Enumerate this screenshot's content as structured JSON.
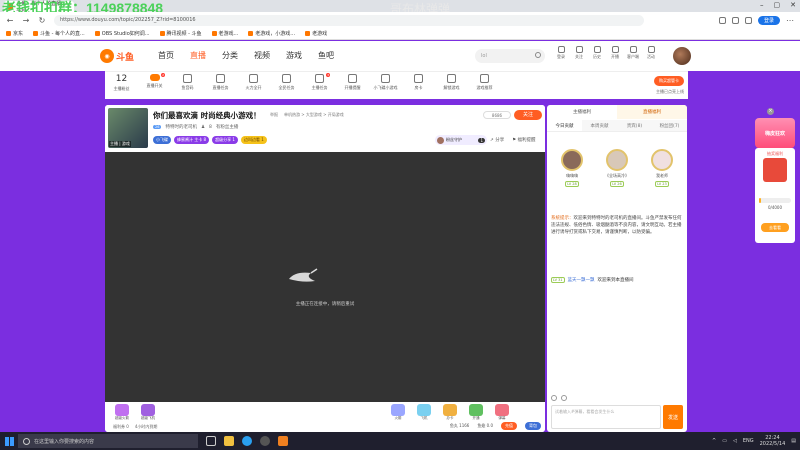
{
  "browser": {
    "tab_title": "斗鱼 - 每个人的直播平台",
    "url": "https://www.douyu.com/topic/202257_Z?rid=8100016",
    "profile_label": "登录",
    "overlay_text": "老钱扣扣群：1149878848",
    "watermark": "哥布林弹弹",
    "bookmarks": [
      "京东",
      "斗鱼 - 每个人的直...",
      "OBS Studio如何调...",
      "腾讯视频 - 斗鱼",
      "老游戏...",
      "老游戏，小游戏...",
      "老游戏"
    ]
  },
  "site": {
    "logo_text": "斗鱼",
    "nav": [
      "首页",
      "直播",
      "分类",
      "视频",
      "游戏",
      "鱼吧"
    ],
    "search_placeholder": "lol",
    "header_icons": [
      "登录",
      "关注",
      "历史",
      "开播",
      "客户端",
      "活动"
    ]
  },
  "subbar": {
    "watch_count": "12",
    "watch_label": "主播粉丝",
    "items": [
      "直播开关",
      "鱼音码",
      "直播任务",
      "火力全开",
      "全民任务",
      "主播任务",
      "开播提醒",
      "小飞碟小游戏",
      "房卡",
      "解锁游戏",
      "游戏推荐"
    ],
    "badges": [
      "2",
      "3"
    ],
    "upgrade_label": "购买超管卡",
    "upgrade_sub": "主播已点亮上线"
  },
  "room": {
    "thumb_label": "主播 | 游戏",
    "title": "你们最喜欢滴 时尚经典小游戏！",
    "meta": [
      "举报",
      "单机热游 > 大型游戏 > 开局游戏"
    ],
    "level": "26",
    "streamer": "特特时的老司机",
    "fans": "8",
    "extra": "有粉丝主播",
    "tags": [
      "小飞碟",
      "蜂蜜酱汁 主卡 8",
      "超级分享 1",
      "边叫边看 1"
    ],
    "share_count": "8686",
    "follow_label": "关注",
    "fan_rank": "粉丝守护",
    "fan_num": "1",
    "share_label": "分享",
    "report_label": "福利提醒",
    "offline_msg": "主播正在连接中，请稍后重试",
    "gifts": [
      "超级火箭",
      "超级飞机",
      "火箭",
      "飞机",
      "办卡",
      "开通",
      "弹幕"
    ],
    "gift_bottom": [
      "鱼丸 1166",
      "鱼翅 0.0",
      "充值",
      "背包"
    ],
    "gift_row2": [
      "福利券 0",
      "4小时内到期"
    ]
  },
  "right": {
    "top": [
      "主播福利",
      "直播福利"
    ],
    "tabs": [
      "今日贡献",
      "本周贡献",
      "贵宾(8)",
      "粉丝团(7)"
    ],
    "rank": [
      {
        "name": "嗨嗨嗨",
        "lv": "LV 28"
      },
      {
        "name": "《全场高冷》",
        "lv": "LV 26"
      },
      {
        "name": "我老师",
        "lv": "LV 23"
      }
    ],
    "system_label": "系统提示：",
    "system_msg": "欢迎来到特特时的老司机的直播间。斗鱼严禁发布任何违法违规、低俗色情、吸烟酗酒等不良内容，请文明互动。若主播进行诱导打赏或私下交易，请谨慎判断，以防受骗。",
    "chat_lv": "LV 31",
    "chat_user": "蓝天一飘一飘",
    "chat_msg": "欢迎来到本直播间",
    "input_placeholder": "试着输入#弹幕，看看会发生什么",
    "send_label": "发送"
  },
  "float": {
    "promo": "嗨皮狂欢",
    "title": "抽奖福利",
    "progress_text": "0/4000",
    "progress_pct": 5,
    "go_label": "去看看"
  },
  "taskbar": {
    "search_placeholder": "在这里输入你要搜索的内容",
    "lang": "ENG",
    "time": "22:24",
    "date": "2022/5/14"
  }
}
